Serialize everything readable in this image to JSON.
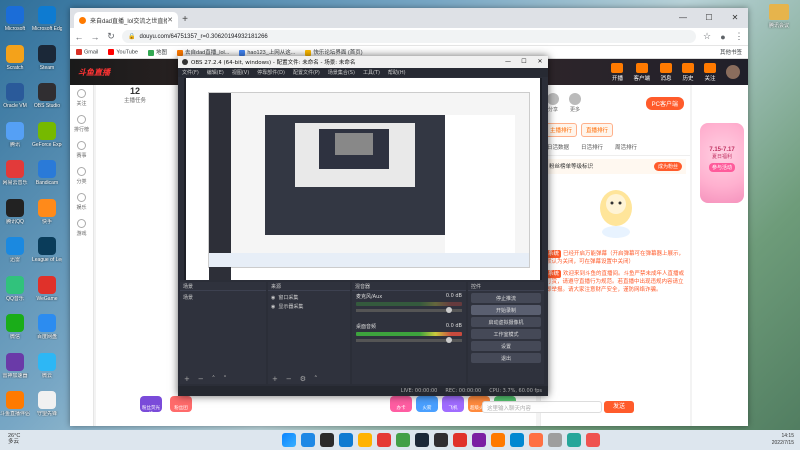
{
  "desktop": {
    "left_icons": [
      {
        "label": "Microsoft",
        "color": "#1b6dd8"
      },
      {
        "label": "Scratch",
        "color": "#f4a21a"
      },
      {
        "label": "Oracle VM",
        "color": "#2a5a9a"
      },
      {
        "label": "腾讯",
        "color": "#55a0f5"
      },
      {
        "label": "网易云音乐",
        "color": "#e23a3a"
      },
      {
        "label": "腾讯QQ",
        "color": "#222222"
      },
      {
        "label": "迅雷",
        "color": "#1b89e0"
      },
      {
        "label": "QQ音乐",
        "color": "#31c27c"
      },
      {
        "label": "微信",
        "color": "#1aad19"
      },
      {
        "label": "雷神加速器",
        "color": "#6a3aa8"
      },
      {
        "label": "斗鱼直播伴侣",
        "color": "#ff7a00"
      }
    ],
    "left_icons2": [
      {
        "label": "Microsoft Edge",
        "color": "#0e7bd1"
      },
      {
        "label": "Steam",
        "color": "#1b2838"
      },
      {
        "label": "OBS Studio",
        "color": "#302e31"
      },
      {
        "label": "GeForce Experience",
        "color": "#76b900"
      },
      {
        "label": "Bandicam",
        "color": "#2a7ad8"
      },
      {
        "label": "快手",
        "color": "#ff8a1a"
      },
      {
        "label": "League of Legends",
        "color": "#0a3c5a"
      },
      {
        "label": "WeGame",
        "color": "#e0312a"
      },
      {
        "label": "百度网盘",
        "color": "#2c8cf0"
      },
      {
        "label": "微云",
        "color": "#2db7f5"
      },
      {
        "label": "守望先锋",
        "color": "#f1f1f1"
      }
    ],
    "right_icon": {
      "label": "腾讯会议"
    }
  },
  "browser": {
    "tab_title": "来自dad直播_lol交流之世直播_",
    "url": "douyu.com/64751357_r=0.3062019493218126​6",
    "bookmarks": [
      "Gmail",
      "YouTube",
      "地图",
      "去自dad直播_lol...",
      "hao123_上网从这...",
      "快乐论坛界面 (首页)"
    ],
    "bookmark_right": "其他书签",
    "site": {
      "logo": "斗鱼直播",
      "header_items": [
        "开播",
        "客户端",
        "消息",
        "历史",
        "关注"
      ],
      "count": "12",
      "count_label": "主播任务",
      "leftnav": [
        "关注",
        "排行榜",
        "赛事",
        "分类",
        "娱乐",
        "游戏"
      ]
    }
  },
  "right_panel": {
    "header": [
      "分享",
      "更多"
    ],
    "pc_btn": "PC客户端",
    "tabs": [
      "主播排行",
      "直播排行"
    ],
    "subtabs": [
      "日活数据",
      "日活排行",
      "周活排行"
    ],
    "notice": "粉丝榜单等级标识",
    "notice_btn": "成为粉丝",
    "messages": [
      {
        "tag": "系统",
        "text": "已经开启万能弹幕（开启弹幕可在弹幕器上展示，默认为关闭，可在弹幕设置中关闭）"
      },
      {
        "tag": "系统",
        "text": "欢迎来到斗鱼的直播间。斗鱼严禁未成年人直播或打赏，请遵守直播行为规范。若直播中出现违规内容请立即举报。请大家注意财产安全，谨防网络诈骗。"
      }
    ],
    "input_placeholder": "这里输入聊天内容",
    "send": "发送"
  },
  "promo": {
    "date": "7.15-7.17",
    "sub": "夏日福利",
    "btn": "参与活动"
  },
  "gifts": [
    "粉丝荧光棒",
    "粉丝团",
    "办卡",
    "火箭",
    "飞机",
    "超级火箭",
    "超级飞机",
    "礼物"
  ],
  "obs": {
    "title": "OBS 27.2.4 (64-bit, windows) - 配置文件: 未命名 - 场景: 未命名",
    "menu": [
      "文件(F)",
      "编辑(E)",
      "视图(V)",
      "停靠部件(D)",
      "配置文件(P)",
      "场景集合(S)",
      "工具(T)",
      "帮助(H)"
    ],
    "docks": {
      "scenes": {
        "title": "场景",
        "items": [
          "场景"
        ]
      },
      "sources": {
        "title": "来源",
        "items": [
          "窗口采集",
          "显示器采集"
        ]
      },
      "mixer": {
        "title": "混音器",
        "channels": [
          {
            "name": "麦克风/Aux",
            "level": "0.0 dB"
          },
          {
            "name": "桌面音频",
            "level": "0.0 dB"
          }
        ]
      },
      "controls": {
        "title": "控件",
        "buttons": [
          "停止推流",
          "开始录制",
          "启动虚拟摄像机",
          "工作室模式",
          "设置",
          "退出"
        ]
      }
    },
    "statusbar": [
      "LIVE: 00:00:00",
      "REC: 00:00:00",
      "CPU: 3.7%, 60.00 fps"
    ],
    "transitions_label": "转场特效"
  },
  "taskbar": {
    "weather": "26°C",
    "weather_sub": "多云",
    "time": "14:15",
    "date": "2022/7/15",
    "apps": [
      "#1e88e5",
      "#2b2b2b",
      "#0e7bd1",
      "#ffb300",
      "#e53935",
      "#43a047",
      "#1b2838",
      "#302e31",
      "#e0312a",
      "#7b1fa2",
      "#ff7a00",
      "#0288d1",
      "#ff7043",
      "#9e9e9e",
      "#26a69a",
      "#ef5350"
    ]
  }
}
